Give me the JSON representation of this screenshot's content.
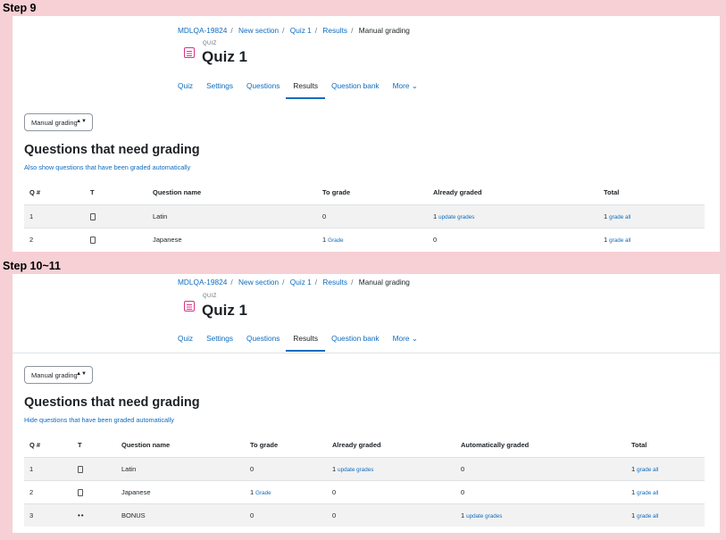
{
  "steps": [
    {
      "label": "Step 9",
      "breadcrumb": [
        "MDLQA-19824",
        "New section",
        "Quiz 1",
        "Results",
        "Manual grading"
      ],
      "header": {
        "label": "QUIZ",
        "title": "Quiz 1"
      },
      "nav": [
        "Quiz",
        "Settings",
        "Questions",
        "Results",
        "Question bank",
        "More ⌄"
      ],
      "active_tab": "Results",
      "select_value": "Manual grading",
      "page_title": "Questions that need grading",
      "toggle_link": "Also show questions that have been graded automatically",
      "columns": [
        "Q #",
        "T",
        "Question name",
        "To grade",
        "Already graded",
        "Total"
      ],
      "rows": [
        {
          "q": "1",
          "name": "Latin",
          "to_grade": "0",
          "to_grade_link": "",
          "already": "1",
          "already_link": "update grades",
          "total": "1",
          "total_link": "grade all"
        },
        {
          "q": "2",
          "name": "Japanese",
          "to_grade": "1",
          "to_grade_link": "Grade",
          "already": "0",
          "already_link": "",
          "total": "1",
          "total_link": "grade all"
        }
      ]
    },
    {
      "label": "Step 10~11",
      "breadcrumb": [
        "MDLQA-19824",
        "New section",
        "Quiz 1",
        "Results",
        "Manual grading"
      ],
      "header": {
        "label": "QUIZ",
        "title": "Quiz 1"
      },
      "nav": [
        "Quiz",
        "Settings",
        "Questions",
        "Results",
        "Question bank",
        "More ⌄"
      ],
      "active_tab": "Results",
      "select_value": "Manual grading",
      "page_title": "Questions that need grading",
      "toggle_link": "Hide questions that have been graded automatically",
      "columns": [
        "Q #",
        "T",
        "Question name",
        "To grade",
        "Already graded",
        "Automatically graded",
        "Total"
      ],
      "rows": [
        {
          "q": "1",
          "name": "Latin",
          "to_grade": "0",
          "to_grade_link": "",
          "already": "1",
          "already_link": "update grades",
          "auto": "0",
          "auto_link": "",
          "total": "1",
          "total_link": "grade all"
        },
        {
          "q": "2",
          "name": "Japanese",
          "to_grade": "1",
          "to_grade_link": "Grade",
          "already": "0",
          "already_link": "",
          "auto": "0",
          "auto_link": "",
          "total": "1",
          "total_link": "grade all"
        },
        {
          "q": "3",
          "name": "BONUS",
          "to_grade": "0",
          "to_grade_link": "",
          "already": "0",
          "already_link": "",
          "auto": "1",
          "auto_link": "update grades",
          "total": "1",
          "total_link": "grade all",
          "bonus": true
        }
      ]
    }
  ],
  "icons": {
    "quiz": "quiz-icon",
    "essay": "essay-question-icon",
    "description": "description-question-icon"
  },
  "colors": {
    "link": "#0f6cbf",
    "quiz_icon": "#d63384",
    "background": "#f6d0d5"
  }
}
